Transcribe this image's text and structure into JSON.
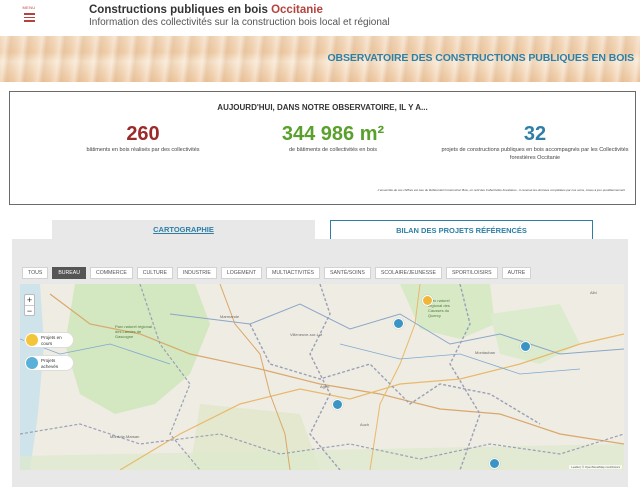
{
  "header": {
    "menu_label": "MENU",
    "title_main": "Constructions publiques en bois ",
    "title_accent": "Occitanie",
    "subtitle": "Information des collectivités sur la construction bois local et régional"
  },
  "banner": {
    "title": "OBSERVATOIRE DES CONSTRUCTIONS PUBLIQUES EN BOIS"
  },
  "stats": {
    "heading": "AUJOURD'HUI, DANS NOTRE OBSERVATOIRE, IL Y A...",
    "items": [
      {
        "value": "260",
        "caption": "bâtiments en bois réalisés par des collectivités",
        "color": "#9b2b2b"
      },
      {
        "value": "344 986 m²",
        "caption": "de bâtiments de collectivités en bois",
        "color": "#5aa02c"
      },
      {
        "value": "32",
        "caption": "projets de constructions publiques en bois accompagnés par les Collectivités forestières Occitanie",
        "color": "#2e7fa6"
      }
    ],
    "footnote": "L'ensemble de ces chiffres est issu du Référentiel Construction Bois, un outil des Collectivités forestières - Il recensé les données complétées par nos soins, mises à jour quotidiennement"
  },
  "tabs": {
    "cartographie": "CARTOGRAPHIE",
    "bilan": "BILAN DES PROJETS RÉFÉRENCÉS"
  },
  "filters": [
    "TOUS",
    "BUREAU",
    "COMMERCE",
    "CULTURE",
    "INDUSTRIE",
    "LOGEMENT",
    "MULTIACTIVITÉS",
    "SANTÉ/SOINS",
    "SCOLAIRE/JEUNESSE",
    "SPORT/LOISIRS",
    "AUTRE"
  ],
  "active_filter": "BUREAU",
  "map": {
    "zoom_in": "+",
    "zoom_out": "−",
    "legend": {
      "en_cours": "Projets en cours",
      "acheves": "Projets achevés"
    },
    "labels": [
      "Parc naturel régional des Landes de Gascogne",
      "Parc naturel régional des Causses du Quercy",
      "Marmande",
      "Villeneuve-sur-Lot",
      "Montauban",
      "Mont-de-Marsan",
      "Auch",
      "Albi",
      "Agen"
    ],
    "attribution": "Leaflet | © OpenStreetMap contributors"
  },
  "colors": {
    "accent": "#b5423c",
    "blue": "#2e7fa6",
    "green": "#5aa02c"
  }
}
